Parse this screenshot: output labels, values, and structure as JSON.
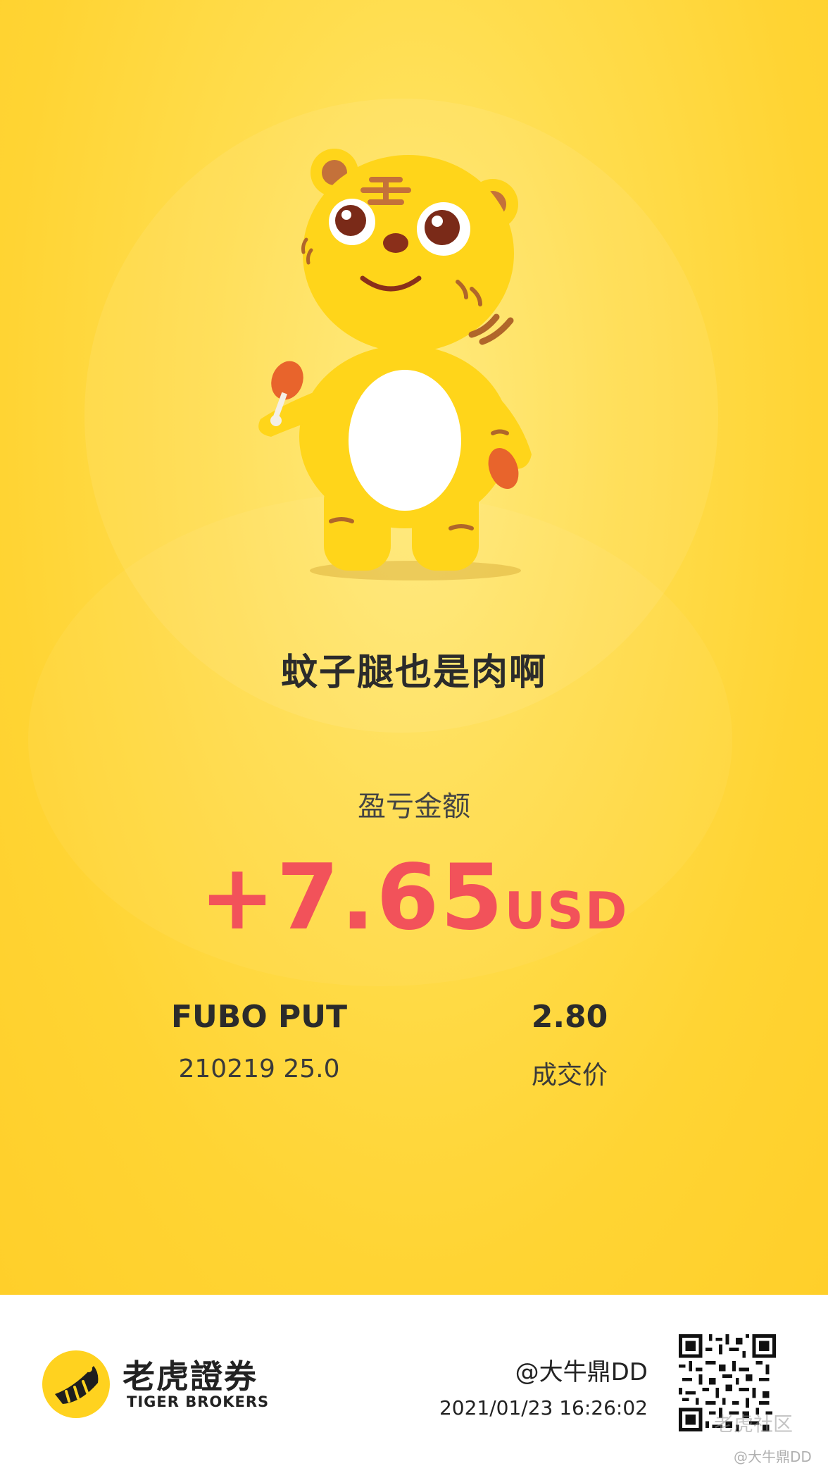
{
  "headline": "蚊子腿也是肉啊",
  "pnl": {
    "label": "盈亏金额",
    "amount": "+7.65",
    "currency": "USD"
  },
  "trade": {
    "symbol": "FUBO PUT",
    "contract": "210219 25.0",
    "price": "2.80",
    "price_label": "成交价"
  },
  "footer": {
    "brand_cn": "老虎證券",
    "brand_en": "TIGER BROKERS",
    "user": "@大牛鼎DD",
    "timestamp": "2021/01/23 16:26:02",
    "watermark": "老虎社区",
    "watermark_user": "@大牛鼎DD"
  },
  "colors": {
    "background": "#ffd433",
    "profit": "#f2525a",
    "text": "#2b2b2b"
  },
  "icons": {
    "mascot": "tiger-mascot-icon",
    "logo": "tiger-logo-icon",
    "qr": "qr-code-icon"
  }
}
